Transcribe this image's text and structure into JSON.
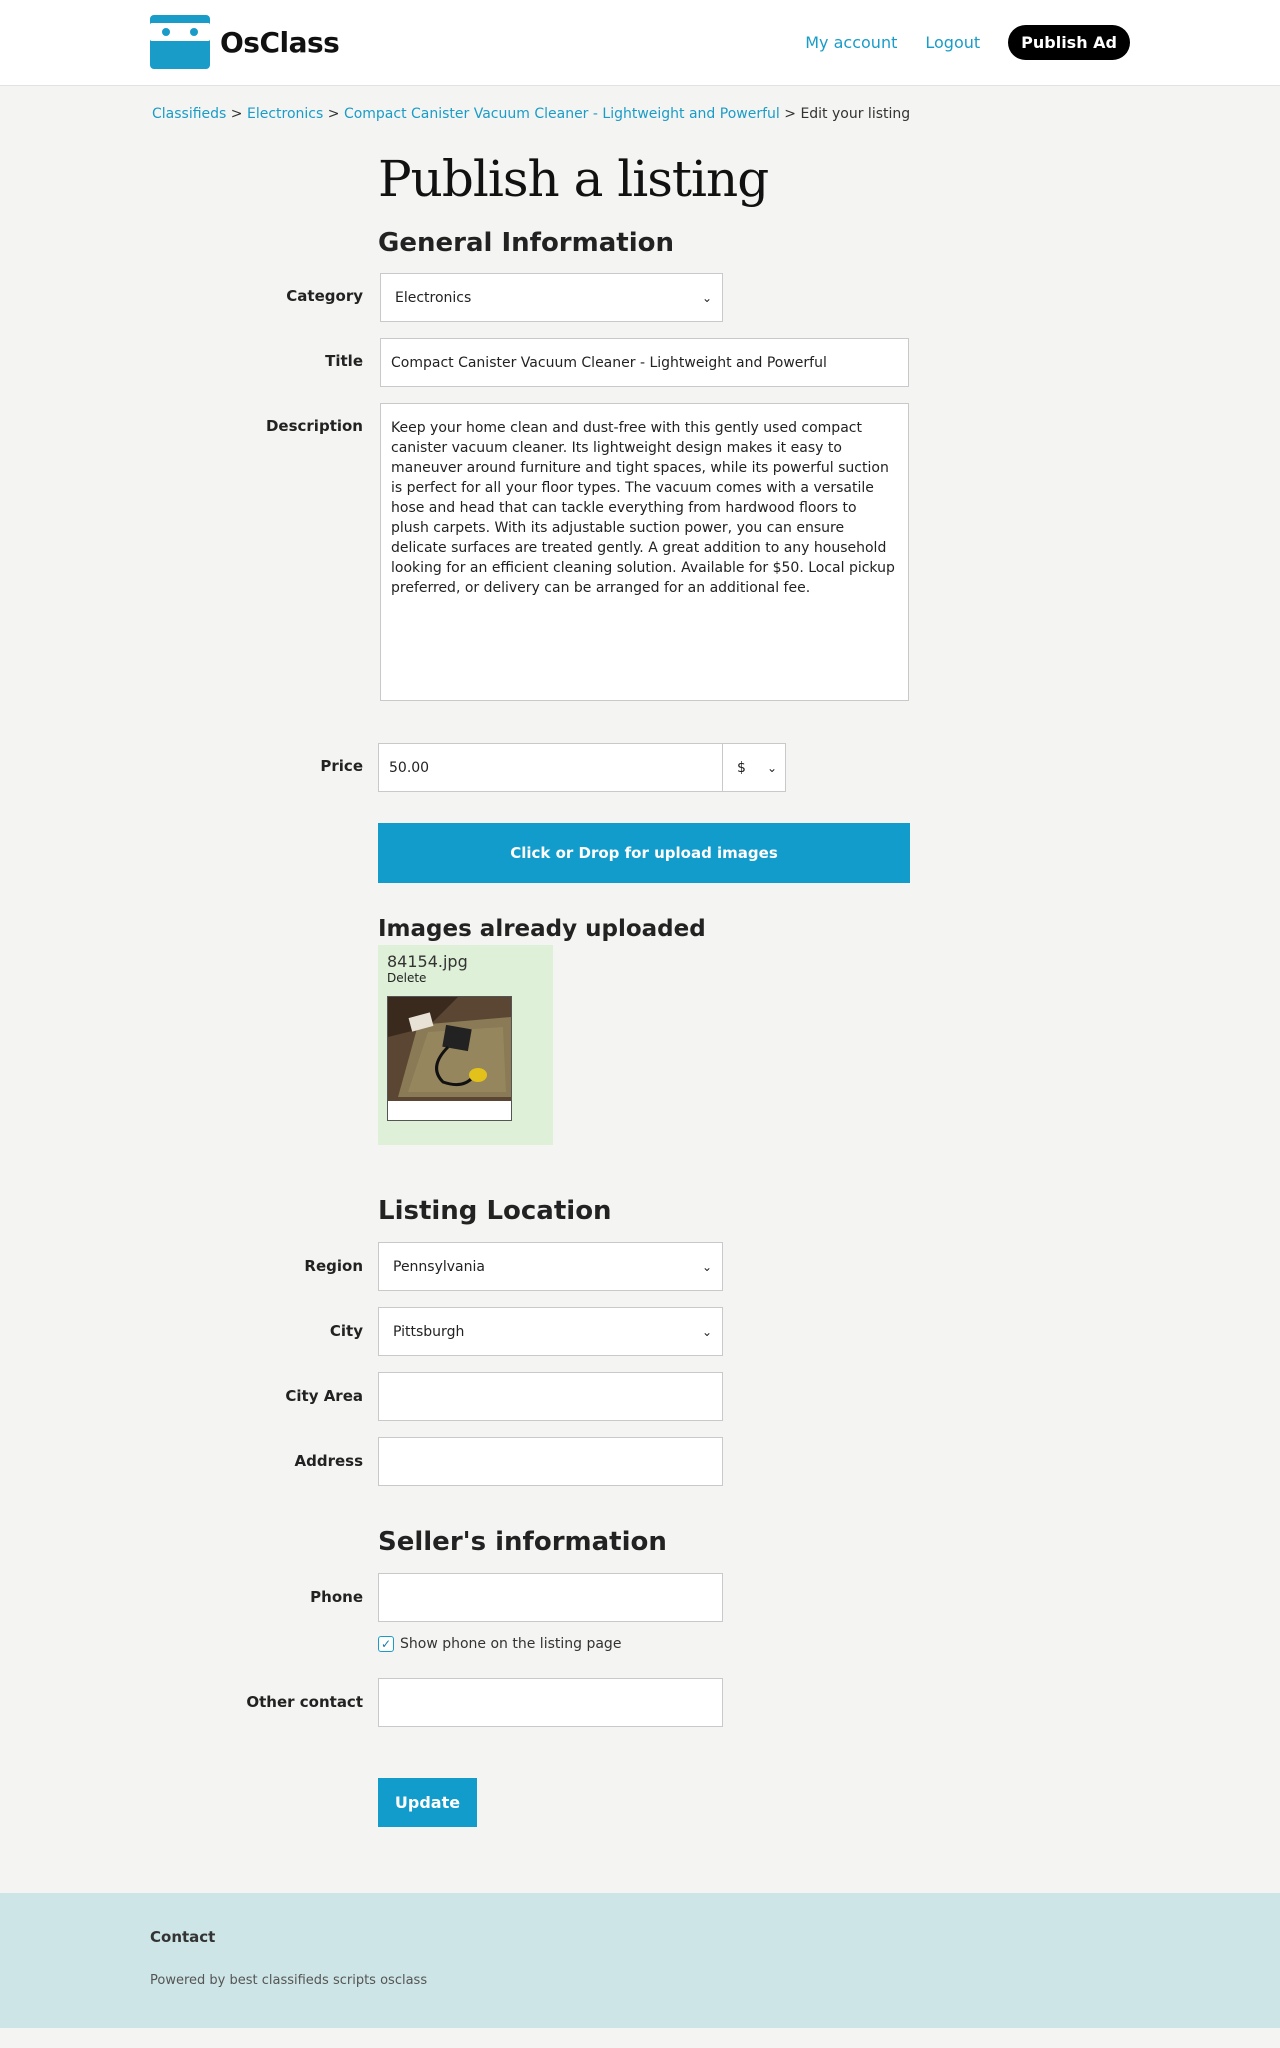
{
  "header": {
    "brand": "OsClass",
    "nav": {
      "my_account": "My account",
      "logout": "Logout",
      "publish_ad": "Publish Ad"
    }
  },
  "breadcrumb": {
    "items": [
      "Classifieds",
      "Electronics",
      "Compact Canister Vacuum Cleaner - Lightweight and Powerful"
    ],
    "current": "Edit your listing",
    "separator": ">"
  },
  "page_title": "Publish a listing",
  "general": {
    "heading": "General Information",
    "category_label": "Category",
    "category_value": "Electronics",
    "title_label": "Title",
    "title_value": "Compact Canister Vacuum Cleaner - Lightweight and Powerful",
    "description_label": "Description",
    "description_value": "Keep your home clean and dust-free with this gently used compact canister vacuum cleaner. Its lightweight design makes it easy to maneuver around furniture and tight spaces, while its powerful suction is perfect for all your floor types. The vacuum comes with a versatile hose and head that can tackle everything from hardwood floors to plush carpets. With its adjustable suction power, you can ensure delicate surfaces are treated gently. A great addition to any household looking for an efficient cleaning solution. Available for $50. Local pickup preferred, or delivery can be arranged for an additional fee.",
    "price_label": "Price",
    "price_value": "50.00",
    "currency_value": "$"
  },
  "upload": {
    "button_label": "Click or Drop for upload images",
    "uploaded_heading": "Images already uploaded",
    "file_name": "84154.jpg",
    "delete_label": "Delete"
  },
  "location": {
    "heading": "Listing Location",
    "region_label": "Region",
    "region_value": "Pennsylvania",
    "city_label": "City",
    "city_value": "Pittsburgh",
    "city_area_label": "City Area",
    "city_area_value": "",
    "address_label": "Address",
    "address_value": ""
  },
  "seller": {
    "heading": "Seller's information",
    "phone_label": "Phone",
    "phone_value": "",
    "show_phone_label": "Show phone on the listing page",
    "show_phone_checked": true,
    "other_contact_label": "Other contact",
    "other_contact_value": ""
  },
  "actions": {
    "update_label": "Update"
  },
  "footer": {
    "contact": "Contact",
    "powered": "Powered by best classifieds scripts osclass"
  },
  "colors": {
    "accent": "#119ccc",
    "link": "#1a9cc8",
    "background": "#f4f4f2",
    "footer": "#cde5e6",
    "uploaded_box": "#dff0d8"
  }
}
